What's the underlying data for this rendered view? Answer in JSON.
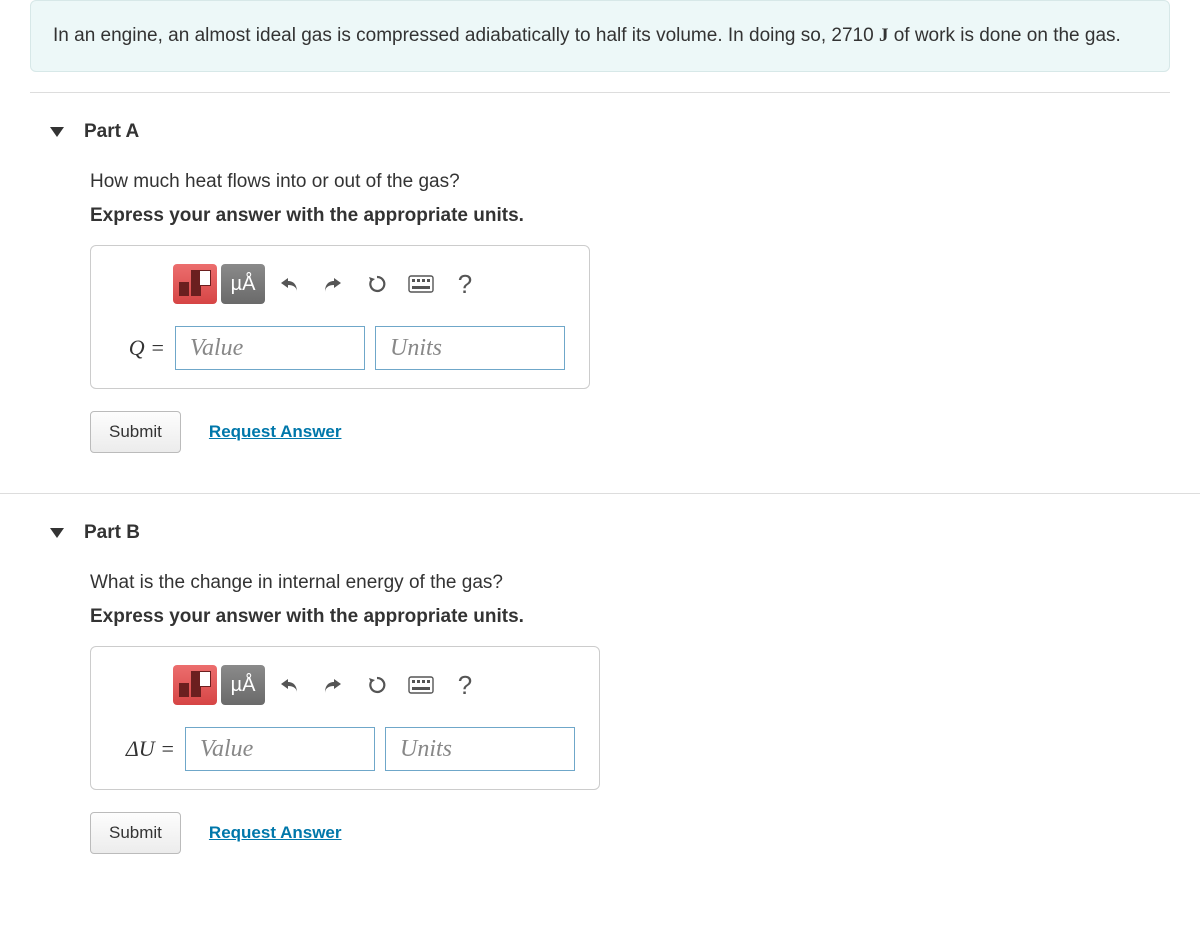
{
  "intro": {
    "pre": "In an engine, an almost ideal gas is compressed adiabatically to half its volume. In doing so, 2710 ",
    "unit": "J",
    "post": " of work is done on the gas."
  },
  "partA": {
    "title": "Part A",
    "question": "How much heat flows into or out of the gas?",
    "hint": "Express your answer with the appropriate units.",
    "toolbar": {
      "mu": "µÅ",
      "help": "?"
    },
    "varLabel": "Q =",
    "valuePlaceholder": "Value",
    "unitsPlaceholder": "Units",
    "submit": "Submit",
    "request": "Request Answer"
  },
  "partB": {
    "title": "Part B",
    "question": "What is the change in internal energy of the gas?",
    "hint": "Express your answer with the appropriate units.",
    "toolbar": {
      "mu": "µÅ",
      "help": "?"
    },
    "varLabel": "ΔU =",
    "valuePlaceholder": "Value",
    "unitsPlaceholder": "Units",
    "submit": "Submit",
    "request": "Request Answer"
  }
}
